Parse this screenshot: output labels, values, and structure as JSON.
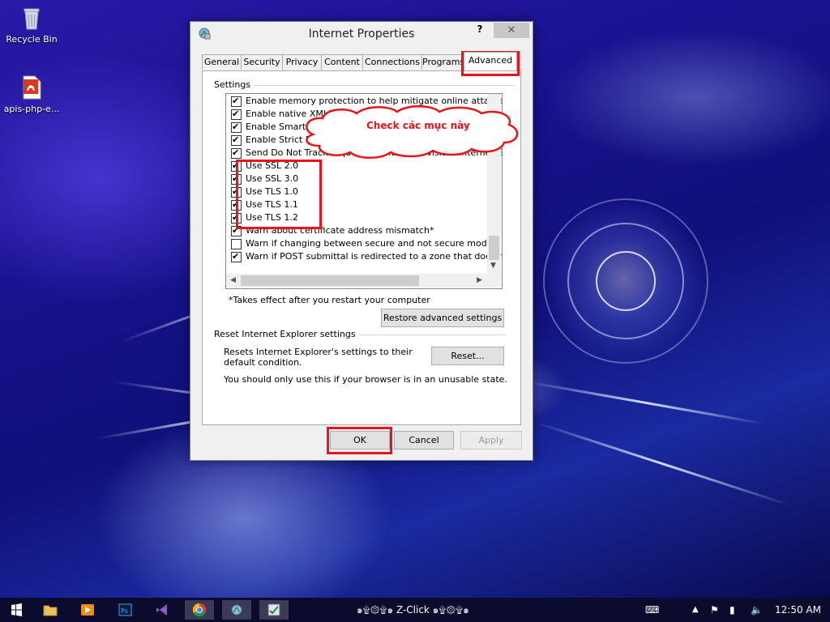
{
  "desktop": {
    "icons": [
      {
        "label": "Recycle Bin"
      },
      {
        "label": "apis-php-e..."
      }
    ]
  },
  "dialog": {
    "title": "Internet Properties",
    "help": "?",
    "close": "✕",
    "tabs": [
      "General",
      "Security",
      "Privacy",
      "Content",
      "Connections",
      "Programs",
      "Advanced"
    ],
    "active_tab": "Advanced",
    "settings_title": "Settings",
    "settings_items": [
      {
        "label": "Enable memory protection to help mitigate online attacks*",
        "checked": true
      },
      {
        "label": "Enable native XMLHTTP support",
        "checked": true
      },
      {
        "label": "Enable SmartScreen Filter",
        "checked": true
      },
      {
        "label": "Enable Strict P3P Validation*",
        "checked": true
      },
      {
        "label": "Send Do Not Track requests to sites you visit in Internet E",
        "checked": true
      },
      {
        "label": "Use SSL 2.0",
        "checked": true
      },
      {
        "label": "Use SSL 3.0",
        "checked": true
      },
      {
        "label": "Use TLS 1.0",
        "checked": true
      },
      {
        "label": "Use TLS 1.1",
        "checked": true
      },
      {
        "label": "Use TLS 1.2",
        "checked": true
      },
      {
        "label": "Warn about certificate address mismatch*",
        "checked": true
      },
      {
        "label": "Warn if changing between secure and not secure mode",
        "checked": false
      },
      {
        "label": "Warn if POST submittal is redirected to a zone that does n",
        "checked": true
      }
    ],
    "restart_note": "*Takes effect after you restart your computer",
    "restore_button": "Restore advanced settings",
    "reset_title": "Reset Internet Explorer settings",
    "reset_desc": "Resets Internet Explorer's settings to their default condition.",
    "reset_button": "Reset...",
    "reset_warning": "You should only use this if your browser is in an unusable state.",
    "ok": "OK",
    "cancel": "Cancel",
    "apply": "Apply"
  },
  "annotation": {
    "callout_text": "Check các mục này",
    "color": "#e8141e"
  },
  "taskbar": {
    "center_text": "๑۩۞۩๑ Z-Click ๑۩۞۩๑",
    "clock": "12:50 AM"
  }
}
